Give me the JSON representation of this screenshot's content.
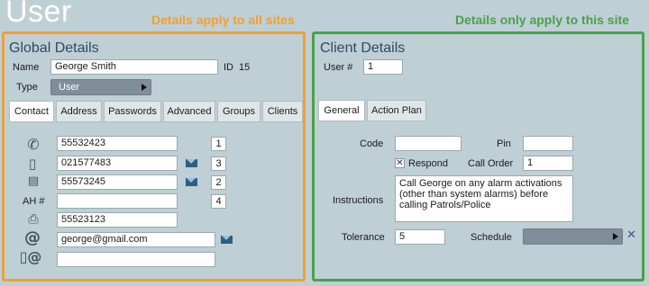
{
  "page": {
    "title": "User",
    "banner_global": "Details apply to all sites",
    "banner_client": "Details only apply to this site"
  },
  "global": {
    "title": "Global Details",
    "name_label": "Name",
    "name_value": "George Smith",
    "id_label": "ID",
    "id_value": "15",
    "type_label": "Type",
    "type_value": "User",
    "tabs": [
      {
        "label": "Contact",
        "active": true
      },
      {
        "label": "Address",
        "active": false
      },
      {
        "label": "Passwords",
        "active": false
      },
      {
        "label": "Advanced",
        "active": false
      },
      {
        "label": "Groups",
        "active": false
      },
      {
        "label": "Clients",
        "active": false
      }
    ],
    "contacts": [
      {
        "icon": "phone-icon",
        "value": "55532423",
        "order": "1",
        "email_action": false
      },
      {
        "icon": "mobile-phone-icon",
        "value": "021577483",
        "order": "3",
        "email_action": true
      },
      {
        "icon": "pager-icon",
        "value": "55573245",
        "order": "2",
        "email_action": true
      },
      {
        "label": "AH #",
        "value": "",
        "order": "4",
        "email_action": false
      },
      {
        "icon": "fax-icon",
        "value": "55523123",
        "order": null,
        "email_action": false
      },
      {
        "icon": "email-icon",
        "value": "george@gmail.com",
        "order": null,
        "email_action": true
      },
      {
        "icon": "mobile-email-icon",
        "value": "",
        "order": null,
        "email_action": false
      }
    ]
  },
  "client": {
    "title": "Client Details",
    "user_no_label": "User #",
    "user_no_value": "1",
    "tabs": [
      {
        "label": "General",
        "active": true
      },
      {
        "label": "Action Plan",
        "active": false
      }
    ],
    "code_label": "Code",
    "code_value": "",
    "pin_label": "Pin",
    "pin_value": "",
    "respond_label": "Respond",
    "respond_checked": true,
    "call_order_label": "Call Order",
    "call_order_value": "1",
    "instructions_label": "Instructions",
    "instructions_value": "Call George on any alarm activations (other than system alarms) before calling Patrols/Police",
    "tolerance_label": "Tolerance",
    "tolerance_value": "5",
    "schedule_label": "Schedule",
    "schedule_value": ""
  },
  "colors": {
    "background": "#bfcfd6",
    "global_border": "#f0a030",
    "client_border": "#4aa04a",
    "heading": "#2e4a63",
    "select_bg": "#7f8e98"
  }
}
